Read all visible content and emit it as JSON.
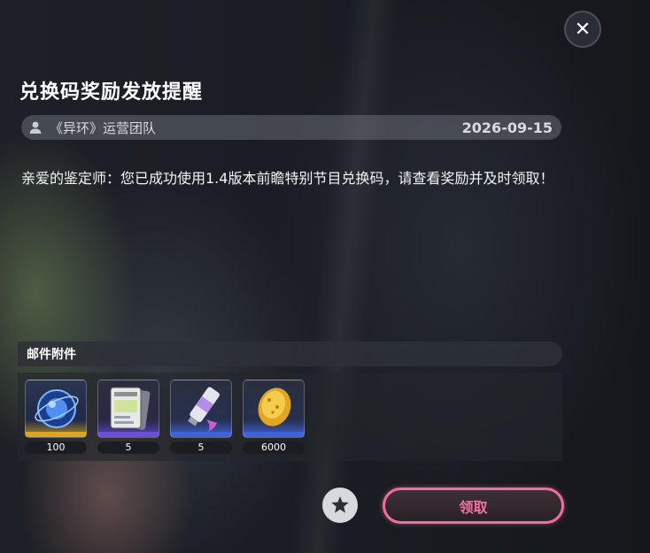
{
  "mail": {
    "title": "兑换码奖励发放提醒",
    "sender": "《异环》运营团队",
    "date": "2026-09-15",
    "body": "亲爱的鉴定师：您已成功使用1.4版本前瞻特别节目兑换码，请查看奖励并及时领取！"
  },
  "attachments": {
    "header": "邮件附件",
    "items": [
      {
        "icon": "blue-orb-icon",
        "count": "100",
        "rarity": "gold"
      },
      {
        "icon": "cards-icon",
        "count": "5",
        "rarity": "purple"
      },
      {
        "icon": "paint-tube-icon",
        "count": "5",
        "rarity": "blue"
      },
      {
        "icon": "gold-egg-icon",
        "count": "6000",
        "rarity": "blue"
      }
    ]
  },
  "actions": {
    "close_icon": "close-icon",
    "favorite_icon": "star-icon",
    "claim_label": "领取"
  },
  "colors": {
    "accent": "#f06e9c",
    "gold_rarity": "#d9a523",
    "purple_rarity": "#6d4fd6",
    "blue_rarity": "#3f62d8"
  }
}
